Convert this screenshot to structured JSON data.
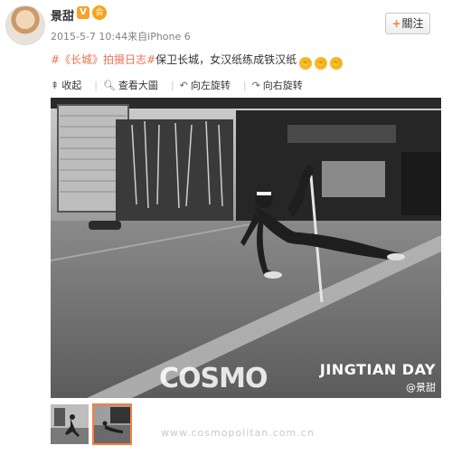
{
  "post": {
    "username": "景甜",
    "verified_mark": "V",
    "vip_mark": "会",
    "timestamp": "2015-5-7 10:44",
    "source": "来自iPhone 6",
    "follow_label": "關注",
    "caption_tag": "#《长城》拍摄日志#",
    "caption_text": "保卫长城，女汉纸练成铁汉纸",
    "emoji_count": 3
  },
  "toolbar": {
    "collapse": "收起",
    "view_large": "查看大圖",
    "rotate_left": "向左旋转",
    "rotate_right": "向右旋转"
  },
  "photo": {
    "watermark_title": "JINGTIAN DAY",
    "watermark_user": "@景甜",
    "overlay_logo": "COSMO"
  },
  "thumbnails": [
    {
      "label": "thumbnail 1",
      "selected": false
    },
    {
      "label": "thumbnail 2",
      "selected": true
    }
  ],
  "site_watermark": "www.cosmopolitan.com.cn",
  "colors": {
    "accent": "#fa7d3c",
    "tag": "#eb7350",
    "verified": "#f7a22a"
  }
}
